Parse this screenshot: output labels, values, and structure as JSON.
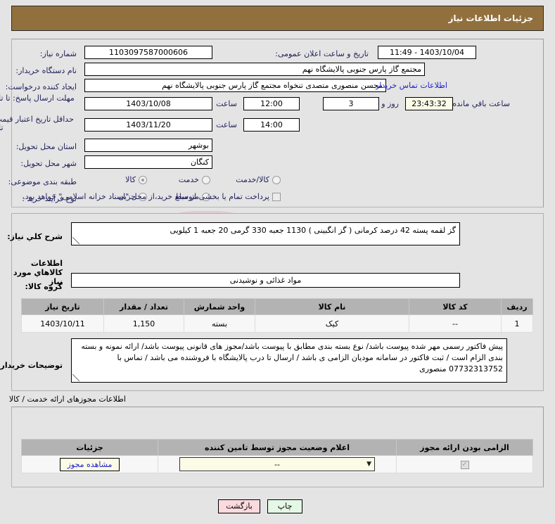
{
  "header": {
    "title": "جزئیات اطلاعات نیاز"
  },
  "watermark": {
    "text": "ariatender.net"
  },
  "top": {
    "need_number_label": "شماره نیاز:",
    "need_number_value": "1103097587000606",
    "announce_label": "تاریخ و ساعت اعلان عمومی:",
    "announce_value": "1403/10/04 - 11:49",
    "buyer_org_label": "نام دستگاه خریدار:",
    "buyer_org_value": "مجتمع گاز پارس جنوبی  پالایشگاه نهم",
    "requester_label": "ایجاد کننده درخواست:",
    "requester_value": "محسن منصوری متصدی تنخواه مجتمع گاز پارس جنوبی  پالایشگاه نهم",
    "contact_link": "اطلاعات تماس خریدار",
    "deadline_label": "مهلت ارسال پاسخ: تا تاریخ:",
    "deadline_date": "1403/10/08",
    "hour_label": "ساعت",
    "deadline_time": "12:00",
    "days_value": "3",
    "days_unit": "روز و",
    "countdown_value": "23:43:32",
    "countdown_unit": "ساعت باقي مانده",
    "validity_label": "حداقل تاریخ اعتبار قیمت: تا تاریخ:",
    "validity_date": "1403/11/20",
    "validity_time": "14:00",
    "province_label": "استان محل تحویل:",
    "province_value": "بوشهر",
    "city_label": "شهر محل تحویل:",
    "city_value": "کنگان",
    "category_label": "طبقه بندی موضوعی:",
    "category_options": [
      "کالا",
      "خدمت",
      "کالا/خدمت"
    ],
    "category_selected": "کالا",
    "process_label": "نوع فرآیند خرید :",
    "process_options": [
      "جزیی",
      "متوسط"
    ],
    "process_selected": null,
    "treasury_checkbox_label": "پرداخت تمام یا بخشی از مبلغ خرید،از محل \"اسناد خزانه اسلامی\" خواهد بود.",
    "treasury_checked": false
  },
  "middle": {
    "summary_label": "شرح کلي نیاز:",
    "summary_value": "گز لقمه پسته 42 درصد کرمانی ( گز انگبینی ) 1130 جعبه 330 گرمی 20 جعبه 1 کیلویی",
    "goods_info_title": "اطلاعات کالاهاي مورد نیاز",
    "group_label": "گروه کالا:",
    "group_value": "مواد غذائی و نوشیدنی",
    "table": {
      "headers": [
        "ردیف",
        "کد کالا",
        "نام کالا",
        "واحد شمارش",
        "تعداد / مقدار",
        "تاریخ نیاز"
      ],
      "rows": [
        [
          "1",
          "--",
          "کیک",
          "بسته",
          "1,150",
          "1403/10/11"
        ]
      ]
    },
    "notes_label": "توضیحات خریدار:",
    "notes_value": "پیش فاکتور رسمی مهر شده پیوست باشد/ نوع بسته بندی مطابق با پیوست باشد/مجوز های قانونی پیوست باشد/ ارائه نمونه و بسته بندی الزام است / ثبت فاکتور در سامانه مودیان الزامی ی باشد /  ارسال تا درب پالایشگاه با فروشنده می باشد / تماس با 07732313752 منصوری"
  },
  "bottom": {
    "section_title": "اطلاعات مجوزهای ارائه خدمت / کالا",
    "table": {
      "headers": [
        "الزامی بودن ارائه مجوز",
        "اعلام وضعیت مجوز توسط تامین کننده",
        "جزئیات"
      ],
      "rows": [
        {
          "required_checked": true,
          "status_value": "--",
          "detail_label": "مشاهده مجوز"
        }
      ]
    }
  },
  "footer": {
    "print_label": "چاپ",
    "back_label": "بازگشت"
  },
  "colors": {
    "header_bg": "#92703e",
    "page_bg": "#e4e4e4",
    "label_text": "#1f1f5c",
    "link": "#2222cc",
    "table_header_bg": "#b3b3b3",
    "print_btn": "#e5f7e5",
    "back_btn": "#fadadd",
    "field_yellow": "#fbfbe8"
  }
}
